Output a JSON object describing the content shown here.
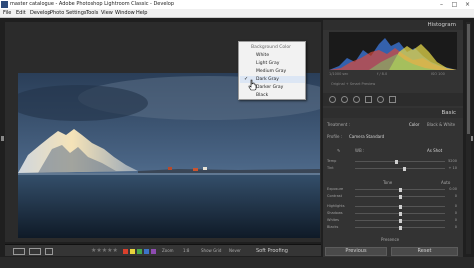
{
  "window": {
    "title": "master catalogue - Adobe Photoshop Lightroom Classic - Develop"
  },
  "menu": [
    "File",
    "Edit",
    "Develop",
    "Photo",
    "Settings",
    "Tools",
    "View",
    "Window",
    "Help"
  ],
  "context_menu": {
    "header": "Background Color",
    "items": [
      "White",
      "Light Gray",
      "Medium Gray",
      "Dark Gray",
      "Darker Gray",
      "Black"
    ],
    "checked": "Dark Gray"
  },
  "right_panel": {
    "histogram_title": "Histogram",
    "histogram_info": [
      "1/1000 sec",
      "f / 8.0",
      "ISO 100"
    ],
    "preview_label": "Original + Smart Preview",
    "basic_title": "Basic",
    "treatment_label": "Treatment :",
    "treatment_options": [
      "Color",
      "Black & White"
    ],
    "profile_label": "Profile :",
    "profile_value": "Camera Standard",
    "wb_label": "WB :",
    "wb_value": "As Shot",
    "tone_label": "Tone",
    "tone_auto": "Auto",
    "presence_label": "Presence",
    "sliders": [
      {
        "label": "Temp",
        "value": "5200",
        "pos": 0.45
      },
      {
        "label": "Tint",
        "value": "+ 10",
        "pos": 0.55
      },
      {
        "label": "Exposure",
        "value": "0.00",
        "pos": 0.5
      },
      {
        "label": "Contrast",
        "value": "0",
        "pos": 0.5
      },
      {
        "label": "Highlights",
        "value": "0",
        "pos": 0.5
      },
      {
        "label": "Shadows",
        "value": "0",
        "pos": 0.5
      },
      {
        "label": "Whites",
        "value": "0",
        "pos": 0.5
      },
      {
        "label": "Blacks",
        "value": "0",
        "pos": 0.5
      }
    ],
    "previous_button": "Previous",
    "reset_button": "Reset"
  },
  "toolbar": {
    "zoom_label": "Zoom",
    "zoom_value": "1:8",
    "grid_label": "Show Grid",
    "grid_value": "Never",
    "soft_proof": "Soft Proofing"
  },
  "colors": {
    "accent_histogram_blue": "#3a7fd8",
    "accent_histogram_yellow": "#e3d64a",
    "menu_highlight": "#dce6f4"
  }
}
